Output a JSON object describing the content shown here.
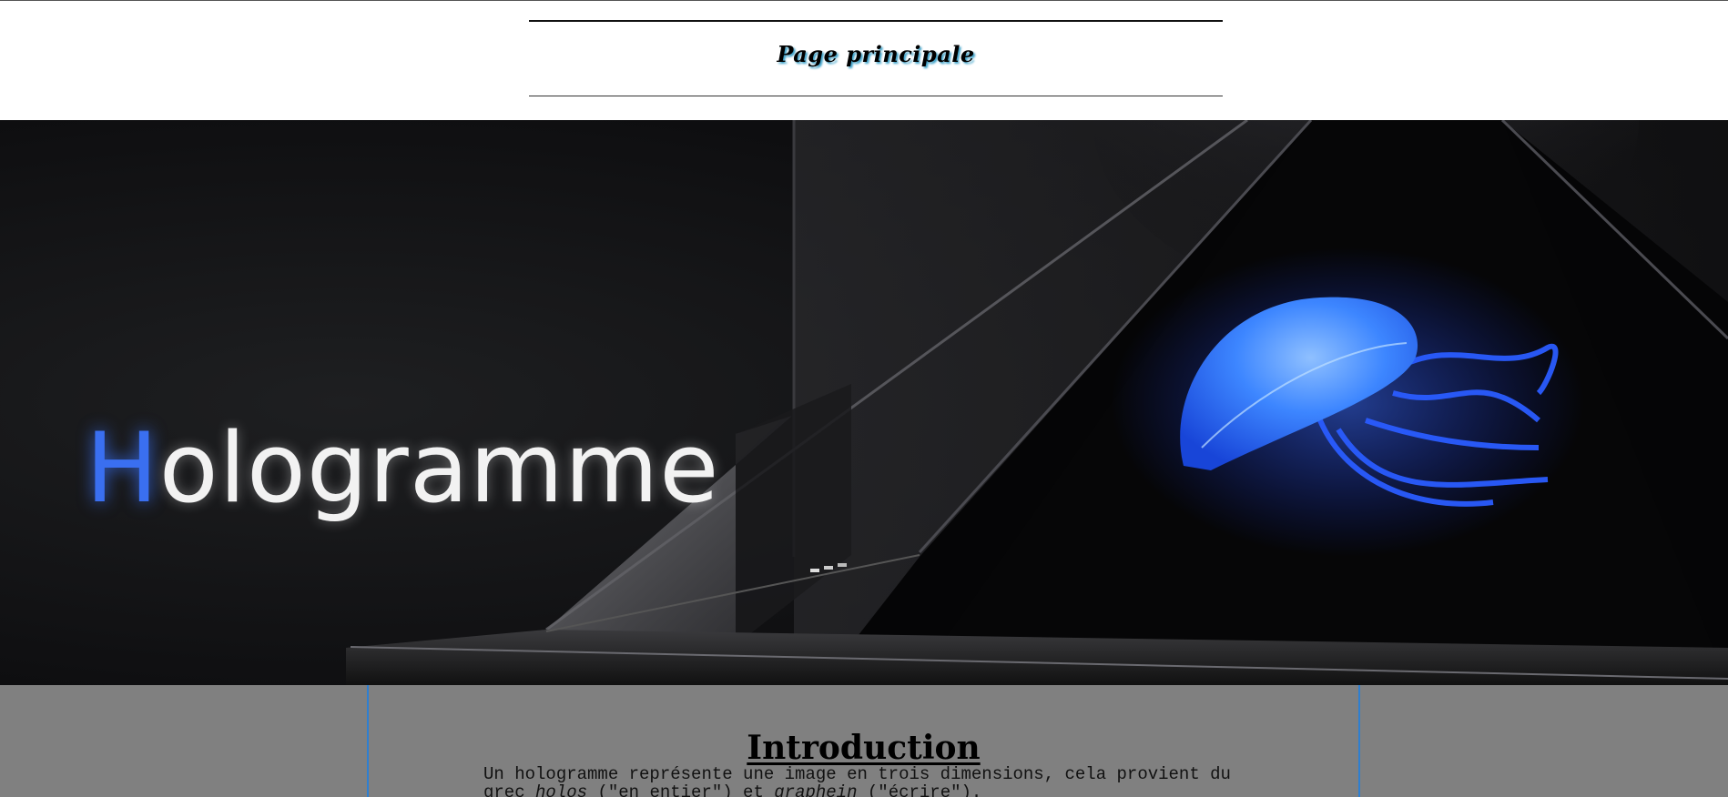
{
  "header": {
    "title": "Page principale"
  },
  "hero": {
    "title_first_letter": "H",
    "title_rest": "ologramme",
    "image_subject": "jellyfish hologram in glass pyramid",
    "accent_color": "#3a6ff0"
  },
  "content": {
    "section_title": "Introduction",
    "paragraph": {
      "part1": "Un hologramme représente une image en trois dimensions, cela provient du grec ",
      "holos": "holos",
      "part2": " (\"en entier\") et ",
      "graphein": "graphein",
      "part3": " (\"écrire\")."
    },
    "frame_color": "#2f7fd0",
    "background_color": "#808080"
  }
}
